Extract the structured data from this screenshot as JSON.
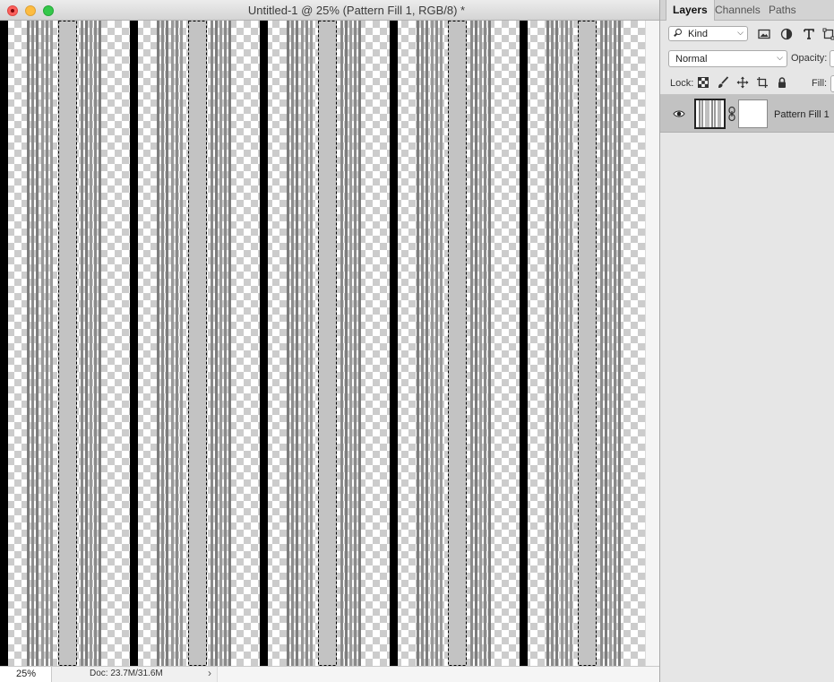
{
  "window": {
    "title": "Untitled-1 @ 25% (Pattern Fill 1, RGB/8) *"
  },
  "status": {
    "zoom": "25%",
    "doc_info": "Doc: 23.7M/31.6M",
    "arrow": "›"
  },
  "panel": {
    "tabs": [
      {
        "label": "Layers",
        "active": true
      },
      {
        "label": "Channels",
        "active": false
      },
      {
        "label": "Paths",
        "active": false
      }
    ],
    "filter_kind": "Kind",
    "filter_icons": [
      "image-filter-icon",
      "adjustment-filter-icon",
      "type-filter-icon",
      "shape-filter-icon"
    ],
    "blend_mode": "Normal",
    "opacity_label": "Opacity:",
    "lock_label": "Lock:",
    "lock_icons": [
      "lock-transparent-icon",
      "lock-image-icon",
      "lock-position-icon",
      "lock-artboard-icon",
      "lock-all-icon"
    ],
    "fill_label": "Fill:",
    "layers": [
      {
        "name": "Pattern Fill 1",
        "visible": true,
        "selected": true
      }
    ]
  },
  "colors": {
    "stripe_black": "#000000",
    "stripe_gray": "#8a8a8a",
    "stripe_light": "#c3c3c3",
    "checker_dark": "#cccccc",
    "selected_layer_bg": "#c2c2c2"
  }
}
